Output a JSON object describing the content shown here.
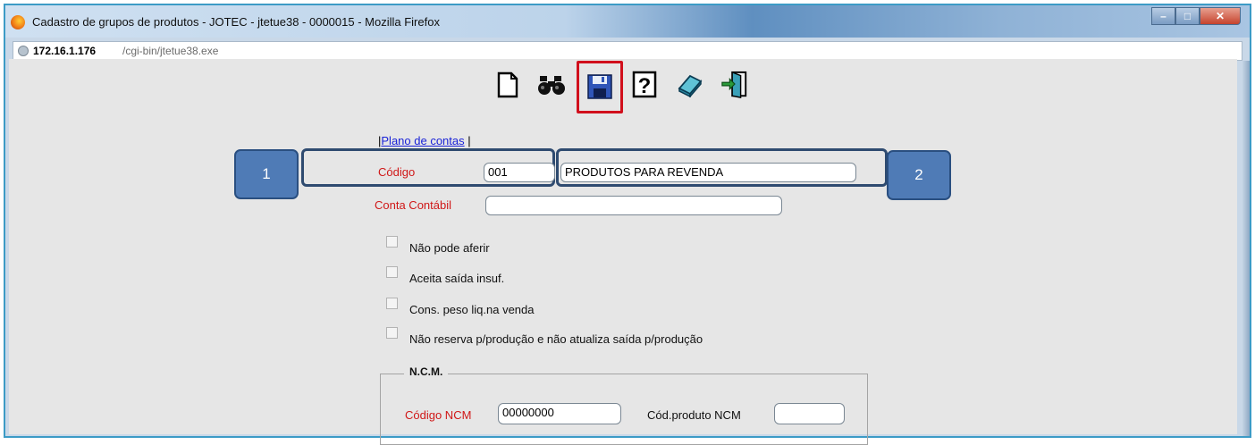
{
  "window": {
    "title": "Cadastro de grupos de produtos - JOTEC - jtetue38 - 0000015 - Mozilla Firefox",
    "buttons": {
      "minimize": "–",
      "maximize": "□",
      "close": "✕"
    }
  },
  "address": {
    "host": "172.16.1.176",
    "path": "/cgi-bin/jtetue38.exe"
  },
  "toolbar": {
    "icons": [
      "new-document-icon",
      "binoculars-search-icon",
      "floppy-save-icon",
      "help-icon",
      "eraser-icon",
      "exit-door-icon"
    ],
    "highlighted": "floppy-save-icon",
    "highlight_color": "#d10f1c"
  },
  "callouts": {
    "one": "1",
    "two": "2",
    "color": "#4f7bb6"
  },
  "links": {
    "prefix": "|",
    "plano_de_contas": "Plano de contas",
    "suffix": "|"
  },
  "form": {
    "codigo_label": "Código",
    "codigo_value": "001",
    "descricao_value": "PRODUTOS PARA REVENDA",
    "conta_contabil_label": "Conta Contábil",
    "conta_contabil_value": "",
    "checkboxes": [
      {
        "label": "Não pode aferir",
        "checked": false
      },
      {
        "label": "Aceita saída insuf.",
        "checked": false
      },
      {
        "label": "Cons. peso liq.na venda",
        "checked": false
      },
      {
        "label": "Não reserva p/produção e não atualiza saída p/produção",
        "checked": false
      }
    ]
  },
  "ncm": {
    "legend": "N.C.M.",
    "codigo_ncm_label": "Código NCM",
    "codigo_ncm_value": "00000000",
    "cod_produto_ncm_label": "Cód.produto NCM",
    "cod_produto_ncm_value": ""
  },
  "colors": {
    "required_label": "#d01818",
    "link": "#1a23d8"
  }
}
